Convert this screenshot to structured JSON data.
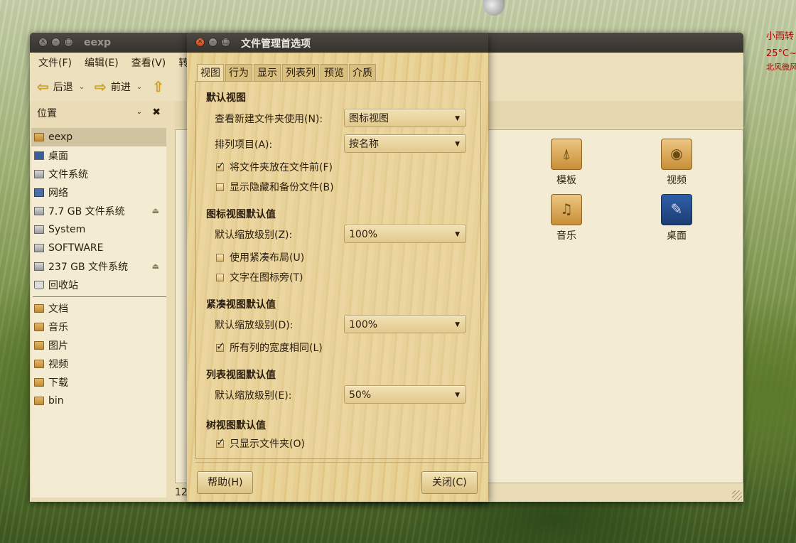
{
  "weather": {
    "line1": "小雨转",
    "line2": "25°C~",
    "line3": "北风微风"
  },
  "main_window": {
    "title": "eexp",
    "menu": [
      "文件(F)",
      "编辑(E)",
      "查看(V)",
      "转"
    ],
    "toolbar": {
      "back": "后退",
      "forward": "前进"
    },
    "sidebar": {
      "header": "位置",
      "places": [
        {
          "label": "eexp",
          "icon": "home-folder-icon"
        },
        {
          "label": "桌面",
          "icon": "desktop-icon"
        },
        {
          "label": "文件系统",
          "icon": "drive-icon"
        },
        {
          "label": "网络",
          "icon": "network-icon"
        },
        {
          "label": "7.7 GB 文件系统",
          "icon": "drive-icon"
        },
        {
          "label": "System",
          "icon": "drive-icon"
        },
        {
          "label": "SOFTWARE",
          "icon": "drive-icon"
        },
        {
          "label": "237 GB 文件系统",
          "icon": "drive-icon"
        },
        {
          "label": "回收站",
          "icon": "trash-icon"
        }
      ],
      "bookmarks": [
        "文档",
        "音乐",
        "图片",
        "视频",
        "下载",
        "bin"
      ]
    },
    "files": [
      {
        "label": "模板",
        "icon": "templates-folder-icon"
      },
      {
        "label": "视频",
        "icon": "videos-folder-icon"
      },
      {
        "label": "音乐",
        "icon": "music-folder-icon"
      },
      {
        "label": "桌面",
        "icon": "desktop-folder-icon"
      }
    ],
    "status": "12"
  },
  "dialog": {
    "title": "文件管理首选项",
    "tabs": [
      "视图",
      "行为",
      "显示",
      "列表列",
      "预览",
      "介质"
    ],
    "default_view": {
      "heading": "默认视图",
      "new_folder_label": "查看新建文件夹使用(N):",
      "new_folder_value": "图标视图",
      "sort_label": "排列项目(A):",
      "sort_value": "按名称",
      "folders_first": "将文件夹放在文件前(F)",
      "show_hidden": "显示隐藏和备份文件(B)"
    },
    "icon_view": {
      "heading": "图标视图默认值",
      "zoom_label": "默认缩放级别(Z):",
      "zoom_value": "100%",
      "compact": "使用紧凑布局(U)",
      "text_beside": "文字在图标旁(T)"
    },
    "compact_view": {
      "heading": "紧凑视图默认值",
      "zoom_label": "默认缩放级别(D):",
      "zoom_value": "100%",
      "same_width": "所有列的宽度相同(L)"
    },
    "list_view": {
      "heading": "列表视图默认值",
      "zoom_label": "默认缩放级别(E):",
      "zoom_value": "50%"
    },
    "tree_view": {
      "heading": "树视图默认值",
      "folders_only": "只显示文件夹(O)"
    },
    "checked": {
      "folders_first": true,
      "show_hidden": false,
      "compact": false,
      "text_beside": false,
      "same_width": true,
      "folders_only": true
    },
    "buttons": {
      "help": "帮助(H)",
      "close": "关闭(C)"
    }
  }
}
